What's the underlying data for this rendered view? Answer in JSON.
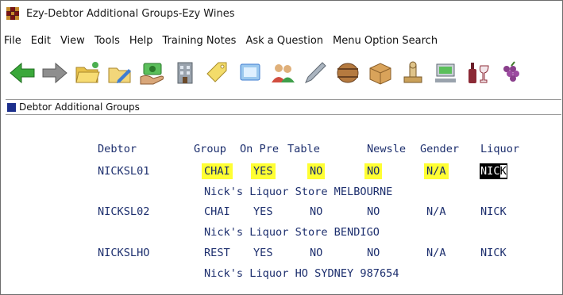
{
  "window": {
    "title": "Ezy-Debtor Additional Groups-Ezy Wines"
  },
  "menu": [
    "File",
    "Edit",
    "View",
    "Tools",
    "Help",
    "Training Notes",
    "Ask a Question",
    "Menu Option Search"
  ],
  "toolbar_icons": [
    "back-arrow-icon",
    "forward-arrow-icon",
    "open-folder-icon",
    "folder-edit-icon",
    "money-hand-icon",
    "building-icon",
    "tag-icon",
    "screen-icon",
    "people-icon",
    "pen-icon",
    "barrel-icon",
    "box-icon",
    "stamp-icon",
    "computer-icon",
    "wine-bottle-icon",
    "grapes-icon"
  ],
  "subwindow": {
    "title": "Debtor Additional Groups"
  },
  "table": {
    "headers": [
      "Debtor",
      "Group",
      "On Pre",
      "Table",
      "Newsle",
      "Gender",
      "Liquor"
    ],
    "rows": [
      {
        "debtor": "NICKSL01",
        "group": "CHAI",
        "on_pre": "YES",
        "table": "NO",
        "newsle": "NO",
        "gender": "N/A",
        "liquor": "NIC",
        "liquor_cursor": "K",
        "name": "Nick's Liquor Store MELBOURNE"
      },
      {
        "debtor": "NICKSL02",
        "group": "CHAI",
        "on_pre": "YES",
        "table": "NO",
        "newsle": "NO",
        "gender": "N/A",
        "liquor": "NICK",
        "name": "Nick's Liquor Store BENDIGO"
      },
      {
        "debtor": "NICKSLHO",
        "group": "REST",
        "on_pre": "YES",
        "table": "NO",
        "newsle": "NO",
        "gender": "N/A",
        "liquor": "NICK",
        "name": "Nick's Liquor HO SYDNEY 987654"
      }
    ]
  },
  "colors": {
    "field_text": "#1d2f6e",
    "highlight": "#ffff33",
    "caption_square": "#1c2f8c"
  }
}
